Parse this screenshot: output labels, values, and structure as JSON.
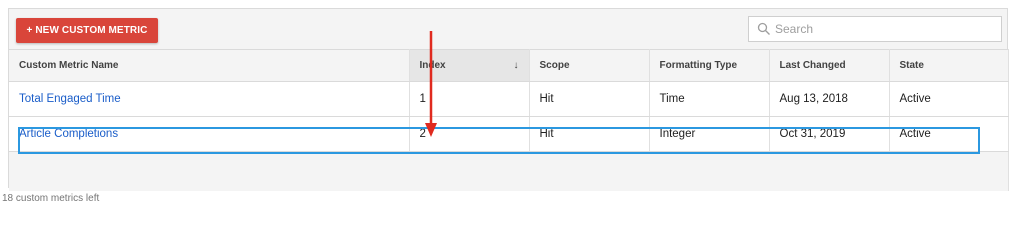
{
  "toolbar": {
    "new_button_label": "+ NEW CUSTOM METRIC",
    "search_placeholder": "Search"
  },
  "table": {
    "columns": [
      "Custom Metric Name",
      "Index",
      "Scope",
      "Formatting Type",
      "Last Changed",
      "State"
    ],
    "sort_indicator": "↓",
    "rows": [
      {
        "name": "Total Engaged Time",
        "index": "1",
        "scope": "Hit",
        "formatting_type": "Time",
        "last_changed": "Aug 13, 2018",
        "state": "Active"
      },
      {
        "name": "Article Completions",
        "index": "2",
        "scope": "Hit",
        "formatting_type": "Integer",
        "last_changed": "Oct 31, 2019",
        "state": "Active"
      }
    ]
  },
  "footer": {
    "remaining_text": "18 custom metrics left"
  },
  "colors": {
    "primary_button": "#d9453a",
    "link": "#1a5dc9",
    "highlight_border": "#2b98e0",
    "annotation_arrow": "#e02a1f"
  },
  "icons": {
    "search": "search-icon",
    "sort": "sort-down-icon",
    "annotation": "red-arrow-icon"
  }
}
